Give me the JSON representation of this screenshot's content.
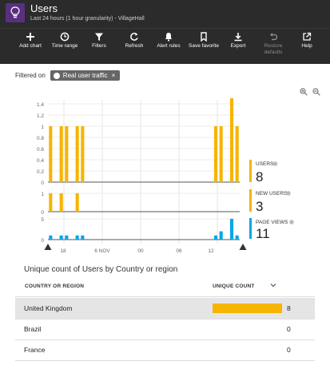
{
  "header": {
    "title": "Users",
    "subtitle": "Last 24 hours (1 hour granularity) - VillageHall",
    "icon": "lightbulb-icon"
  },
  "toolbar": [
    {
      "id": "add-chart",
      "label": "Add chart",
      "icon": "plus-icon",
      "enabled": true
    },
    {
      "id": "time-range",
      "label": "Time range",
      "icon": "clock-icon",
      "enabled": true
    },
    {
      "id": "filters",
      "label": "Filters",
      "icon": "funnel-icon",
      "enabled": true
    },
    {
      "id": "refresh",
      "label": "Refresh",
      "icon": "refresh-icon",
      "enabled": true
    },
    {
      "id": "alert-rules",
      "label": "Alert rules",
      "icon": "bell-icon",
      "enabled": true
    },
    {
      "id": "save-favorite",
      "label": "Save favorite",
      "icon": "bookmark-icon",
      "enabled": true
    },
    {
      "id": "export",
      "label": "Export",
      "icon": "download-icon",
      "enabled": true
    },
    {
      "id": "restore-defaults",
      "label": "Restore defaults",
      "icon": "undo-icon",
      "enabled": false
    },
    {
      "id": "help",
      "label": "Help",
      "icon": "external-link-icon",
      "enabled": true
    }
  ],
  "filter": {
    "label": "Filtered on",
    "chip": "Real user traffic",
    "chip_close": "×"
  },
  "chart_data": {
    "type": "bar",
    "x_ticks": [
      "18",
      "6 NOV",
      "00",
      "06",
      "12"
    ],
    "panels": [
      {
        "name": "USERS",
        "total": "8",
        "color": "#f6b500",
        "y_ticks": [
          "1.4",
          "1.2",
          "1",
          "0.8",
          "0.6",
          "0.4",
          "0.2",
          "0"
        ],
        "ylim": [
          0,
          1.4
        ],
        "values": [
          1,
          0,
          1,
          1,
          0,
          1,
          1,
          0,
          0,
          0,
          0,
          0,
          0,
          0,
          0,
          0,
          0,
          0,
          0,
          0,
          0,
          0,
          0,
          0,
          0,
          0,
          0,
          0,
          0,
          0,
          0,
          1,
          1,
          0,
          1.5,
          1
        ]
      },
      {
        "name": "NEW USERS",
        "total": "3",
        "color": "#f6b500",
        "y_ticks": [
          "1",
          "0"
        ],
        "ylim": [
          0,
          1
        ],
        "values": [
          1,
          0,
          1,
          0,
          0,
          1,
          0,
          0,
          0,
          0,
          0,
          0,
          0,
          0,
          0,
          0,
          0,
          0,
          0,
          0,
          0,
          0,
          0,
          0,
          0,
          0,
          0,
          0,
          0,
          0,
          0,
          0,
          0,
          0,
          0,
          0
        ]
      },
      {
        "name": "PAGE VIEWS",
        "total": "11",
        "color": "#0aa5e6",
        "y_ticks": [
          "5",
          "0"
        ],
        "ylim": [
          0,
          5
        ],
        "values": [
          1,
          0,
          1,
          1,
          0,
          1,
          1,
          0,
          0,
          0,
          0,
          0,
          0,
          0,
          0,
          0,
          0,
          0,
          0,
          0,
          0,
          0,
          0,
          0,
          0,
          0,
          0,
          0,
          0,
          0,
          0,
          1,
          2,
          0,
          5,
          1
        ]
      }
    ]
  },
  "table": {
    "title": "Unique count of Users by Country or region",
    "col_country": "COUNTRY OR REGION",
    "col_count": "UNIQUE COUNT",
    "sort_icon": "chevron-down-icon",
    "bar_color": "#f6b500",
    "max": 8,
    "rows": [
      {
        "country": "United Kingdom",
        "count": 8,
        "count_text": "8"
      },
      {
        "country": "Brazil",
        "count": 0,
        "count_text": "0"
      },
      {
        "country": "France",
        "count": 0,
        "count_text": "0"
      }
    ]
  }
}
